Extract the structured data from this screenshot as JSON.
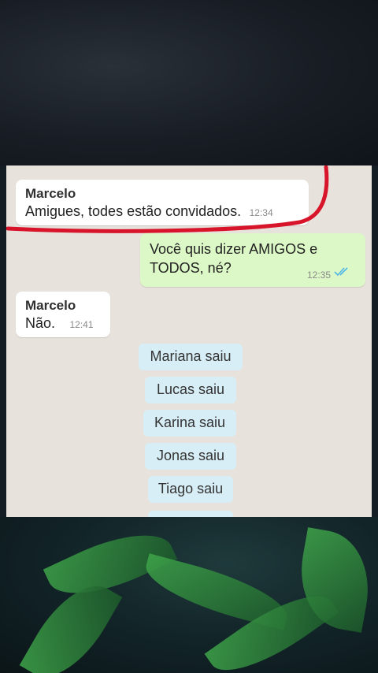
{
  "messages": [
    {
      "sender": "Marcelo",
      "text": "Amigues, todes estão convidados.",
      "time": "12:34"
    },
    {
      "text_line1": "Você quis dizer AMIGOS e",
      "text_line2": "TODOS, né?",
      "time": "12:35"
    },
    {
      "sender": "Marcelo",
      "text": "Não.",
      "time": "12:41"
    }
  ],
  "system_messages": [
    "Mariana saiu",
    "Lucas saiu",
    "Karina saiu",
    "Jonas saiu",
    "Tiago saiu"
  ],
  "colors": {
    "chat_bg": "#e7e2dc",
    "incoming": "#ffffff",
    "outgoing": "#dcf8c6",
    "system": "#d8eef6",
    "highlight": "#d8142a",
    "read_ticks": "#4fb6e8"
  },
  "icons": {
    "read_receipt": "double-check-icon"
  }
}
